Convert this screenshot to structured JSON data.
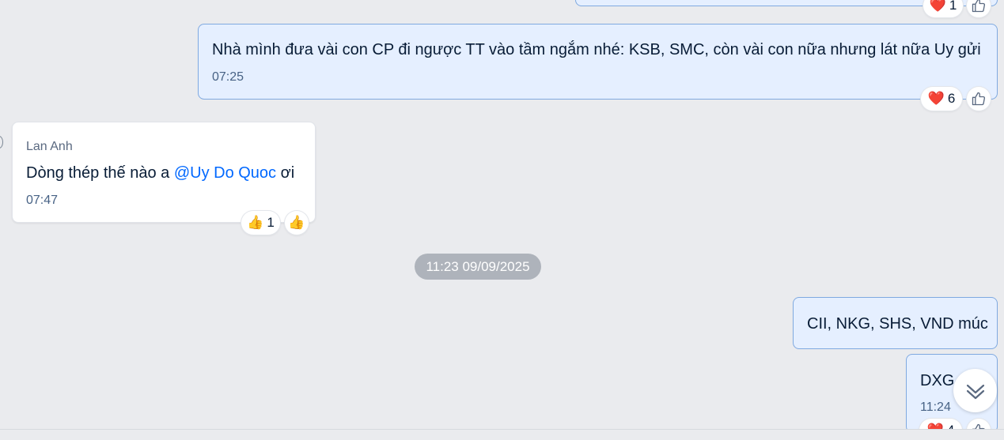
{
  "messages": [
    {
      "id": "prev",
      "sender": "",
      "text": "",
      "time": "",
      "reaction": {
        "emoji": "❤️",
        "count": "1"
      }
    },
    {
      "id": "m1",
      "text": "Nhà mình đưa vài con CP đi ngược TT vào tầm ngắm nhé: KSB, SMC, còn vài con nữa nhưng lát nữa Uy gửi",
      "time": "07:25",
      "reaction": {
        "emoji": "❤️",
        "count": "6"
      }
    },
    {
      "id": "m2",
      "sender": "Lan Anh",
      "text_before": "Dòng thép thế nào a ",
      "mention": "@Uy Do Quoc",
      "text_after": " ơi",
      "time": "07:47",
      "reaction": {
        "emoji": "👍",
        "count": "1"
      },
      "quick_reaction": "👍"
    },
    {
      "id": "m3",
      "text": "CII, NKG, SHS, VND múc"
    },
    {
      "id": "m4",
      "text": "DXG",
      "time": "11:24",
      "reaction": {
        "emoji": "❤️",
        "count": "4"
      }
    }
  ],
  "date_separator": "11:23 09/09/2025",
  "colors": {
    "background": "#eaebee",
    "my_bubble": "#e5efff",
    "my_bubble_border": "#7fa9e0",
    "mention": "#0068ff",
    "date_chip": "#aeb3bb"
  },
  "icons": {
    "like_outline": "thumbs-up-outline-icon",
    "scroll_down": "double-chevron-down-icon"
  }
}
